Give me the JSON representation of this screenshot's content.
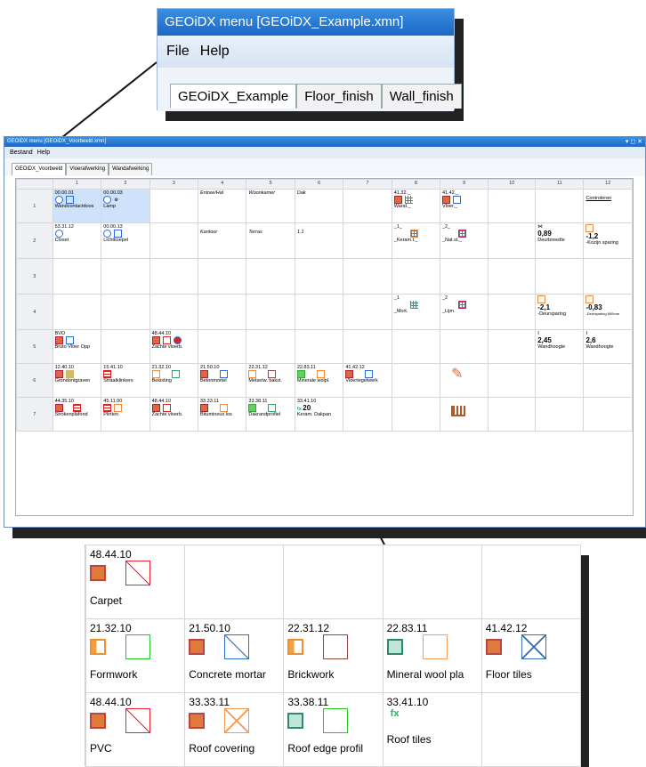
{
  "zoom_top": {
    "title": "GEOiDX menu [GEOiDX_Example.xmn]",
    "menu": [
      "File",
      "Help"
    ],
    "tabs": [
      "GEOiDX_Example",
      "Floor_finish",
      "Wall_finish"
    ]
  },
  "main": {
    "title": "GEOiDX menu [GEOiDX_Voorbeeld.xmn]",
    "controls": "▾ ◻ ✕",
    "menu": [
      "Bestand",
      "Help"
    ],
    "tabs": [
      "GEOiDX_Voorbeeld",
      "Vloerafwerking",
      "Wandafwerking"
    ],
    "columns": [
      "1",
      "2",
      "3",
      "4",
      "5",
      "6",
      "7",
      "8",
      "9",
      "10",
      "11",
      "12"
    ],
    "rows": [
      "1",
      "2",
      "3",
      "4",
      "5",
      "6",
      "7"
    ],
    "cells": {
      "r1": {
        "c1_code": "00.00.01",
        "c1_label": "Wandcontactdoos",
        "c2_code": "00.00.03",
        "c2_label": "Lamp",
        "c4": "Entree/Hal",
        "c5": "Woonkamer",
        "c6": "Dak",
        "c8_code": "41.32._",
        "c8_label": "Wand._",
        "c9_code": "41.42._",
        "c9_label": "Vloer._",
        "c12": "Controleren"
      },
      "r2": {
        "c1_code": "53.31.12",
        "c1_label": "Closet",
        "c2_code": "00.00.13",
        "c2_label": "Lichtkoepel",
        "c4": "Kantoor",
        "c5": "Terras",
        "c6": "1.1",
        "c8_code": "_1_",
        "c8_label": "_Keram.t._",
        "c9_code": "_2_",
        "c9_label": "_Nat.st._",
        "c11_val": "0,89",
        "c11_label": "Deurbreedte",
        "c12_val": "-1,2",
        "c12_label": "-Kozijn sparing"
      },
      "r4": {
        "c8_code": "_1",
        "c8_label": "_Mort.",
        "c9_code": "_2",
        "c9_label": "_Lijm.",
        "c11_val": "-2,1",
        "c11_label": "-Deursparing",
        "c12_val": "-0,83",
        "c12_label": "-Deursparing 800mm"
      },
      "r5": {
        "c1_code": "BVO",
        "c1_label": "Bruto Vloer Opp",
        "c3_code": "48.44.10",
        "c3_label": "Zachte vloerb.",
        "c11_val": "2,45",
        "c11_label": "Wandhoogte",
        "c12_val": "2,6",
        "c12_label": "Wandhoogte"
      },
      "r6": {
        "c1_code": "12.40.10",
        "c1_label": "Grondontgraven",
        "c2_code": "15.41.10",
        "c2_label": "Straatklinkers",
        "c3_code": "21.32.10",
        "c3_label": "Bekisting",
        "c4_code": "21.50.10",
        "c4_label": "Betonmortel",
        "c5_code": "22.31.12",
        "c5_label": "Metselw. bakst.",
        "c6_code": "22.83.11",
        "c6_label": "Minerale wolpl.",
        "c7_code": "41.42.12",
        "c7_label": "Vloertegelwerk"
      },
      "r7": {
        "c1_code": "44.35.10",
        "c1_label": "Strokenplafond",
        "c2_code": "45.11.00",
        "c2_label": "Plinten",
        "c3_code": "48.44.10",
        "c3_label": "Zachte vloerb.",
        "c4_code": "33.33.11",
        "c4_label": "Bitumineus los",
        "c5_code": "33.38.11",
        "c5_label": "Dakrandprofiel",
        "c6_code": "33.41.10",
        "c6_num": "20",
        "c6_label": "Keram. Dakpan"
      }
    }
  },
  "zoom_bottom": {
    "rows": [
      [
        {
          "code": "48.44.10",
          "label": "Carpet"
        },
        {
          "code": "",
          "label": ""
        },
        {
          "code": "",
          "label": ""
        },
        {
          "code": "",
          "label": ""
        },
        {
          "code": "",
          "label": ""
        }
      ],
      [
        {
          "code": "21.32.10",
          "label": "Formwork"
        },
        {
          "code": "21.50.10",
          "label": "Concrete mortar"
        },
        {
          "code": "22.31.12",
          "label": "Brickwork"
        },
        {
          "code": "22.83.11",
          "label": "Mineral wool pla"
        },
        {
          "code": "41.42.12",
          "label": "Floor tiles"
        }
      ],
      [
        {
          "code": "48.44.10",
          "label": "PVC"
        },
        {
          "code": "33.33.11",
          "label": "Roof covering"
        },
        {
          "code": "33.38.11",
          "label": "Roof edge profil"
        },
        {
          "code": "33.41.10",
          "label": "Roof tiles"
        },
        {
          "code": "",
          "label": ""
        }
      ]
    ]
  }
}
